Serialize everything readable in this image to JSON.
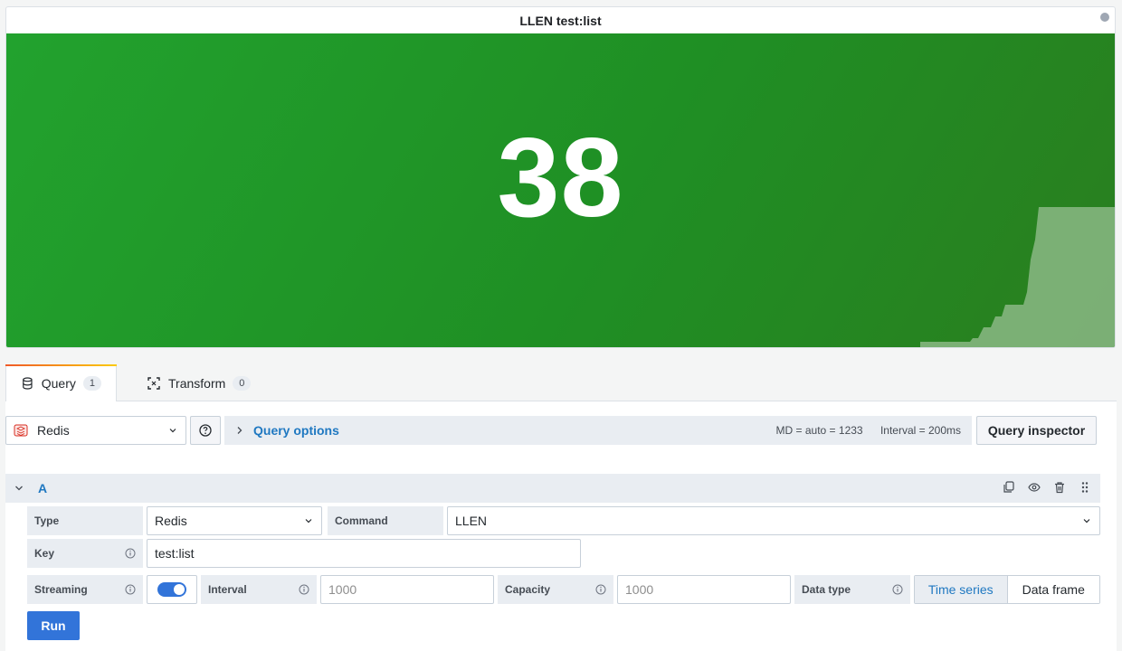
{
  "panel": {
    "title": "LLEN test:list",
    "stat_value": "38",
    "background_color": "#22a22e",
    "sparkline_color": "#7fb27a"
  },
  "tabs": [
    {
      "label": "Query",
      "count": "1",
      "icon": "database-icon"
    },
    {
      "label": "Transform",
      "count": "0",
      "icon": "transform-icon"
    }
  ],
  "datasource": {
    "name": "Redis",
    "icon": "redis-icon"
  },
  "query_options": {
    "label": "Query options",
    "md": "MD = auto = 1233",
    "interval": "Interval = 200ms"
  },
  "query_inspector_label": "Query inspector",
  "query": {
    "ref_id": "A",
    "type_label": "Type",
    "type_value": "Redis",
    "command_label": "Command",
    "command_value": "LLEN",
    "key_label": "Key",
    "key_value": "test:list",
    "streaming_label": "Streaming",
    "streaming_on": true,
    "interval_label": "Interval",
    "interval_placeholder": "1000",
    "capacity_label": "Capacity",
    "capacity_placeholder": "1000",
    "data_type_label": "Data type",
    "data_type_options": [
      "Time series",
      "Data frame"
    ],
    "data_type_selected": "Time series"
  },
  "run_label": "Run",
  "accent_color": "#3274d9",
  "link_color": "#1f78c1"
}
